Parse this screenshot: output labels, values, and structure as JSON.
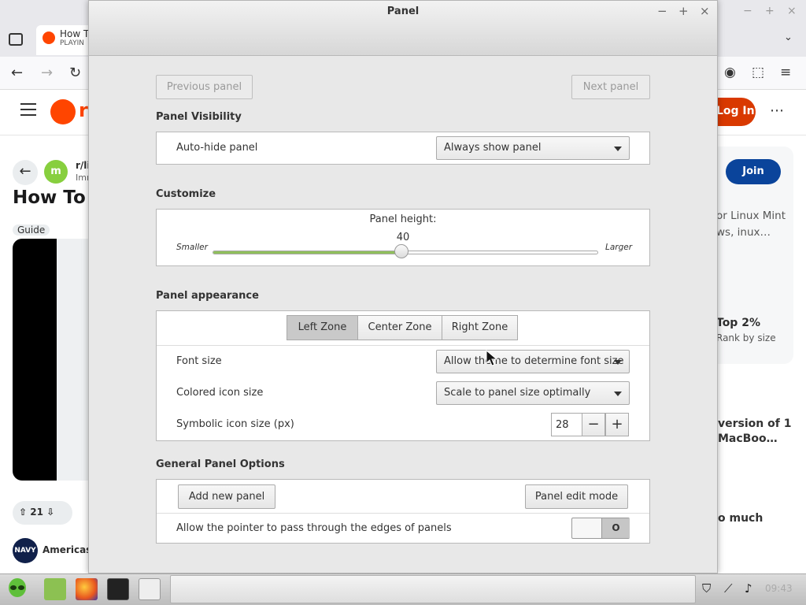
{
  "browser": {
    "tab": {
      "title": "How T",
      "subtitle": "PLAYIN"
    },
    "window_controls": {
      "minimize": "−",
      "maximize": "+",
      "close": "×"
    },
    "tab_list_chevron": "⌄",
    "nav": {
      "back": "←",
      "forward": "→",
      "reload": "↻"
    },
    "reddit": {
      "logo_text": "r",
      "login": "Log In",
      "more": "⋯",
      "back": "←",
      "subreddit_avatar": "m",
      "subreddit": "r/li",
      "subreddit_sub": "Imr",
      "post_title": "How To I",
      "flair": "Guide",
      "votes": "21",
      "ad_avatar": "NAVY",
      "ad_name": "AmericasN",
      "join": "Join",
      "side_desc": "or Linux Mint ws, inux…",
      "side_top": "Top 2%",
      "side_rank": "Rank by size",
      "side_related": "version of 1 MacBoo…",
      "side_much": "o much"
    }
  },
  "dialog": {
    "title": "Panel",
    "window_controls": {
      "minimize": "−",
      "maximize": "+",
      "close": "×"
    },
    "previous_panel": "Previous panel",
    "next_panel": "Next panel",
    "visibility": {
      "heading": "Panel Visibility",
      "autohide_label": "Auto-hide panel",
      "autohide_value": "Always show panel"
    },
    "customize": {
      "heading": "Customize",
      "height_label": "Panel height:",
      "height_value": "40",
      "height_fraction": 0.49,
      "smaller": "Smaller",
      "larger": "Larger"
    },
    "appearance": {
      "heading": "Panel appearance",
      "zones": [
        "Left Zone",
        "Center Zone",
        "Right Zone"
      ],
      "active_zone": "Left Zone",
      "font_size_label": "Font size",
      "font_size_value": "Allow theme to determine font size",
      "colored_icon_label": "Colored icon size",
      "colored_icon_value": "Scale to panel size optimally",
      "symbolic_icon_label": "Symbolic icon size (px)",
      "symbolic_icon_value": "28",
      "minus": "−",
      "plus": "+"
    },
    "general": {
      "heading": "General Panel Options",
      "add_new_panel": "Add new panel",
      "panel_edit_mode": "Panel edit mode",
      "pointer_pass_label": "Allow the pointer to pass through the edges of panels",
      "pointer_pass_state": "O"
    }
  },
  "taskbar": {
    "clock": "09:43"
  },
  "colors": {
    "slider_fill": "#8fbf5b",
    "reddit_orange": "#ff4500",
    "join_blue": "#0a449b"
  }
}
